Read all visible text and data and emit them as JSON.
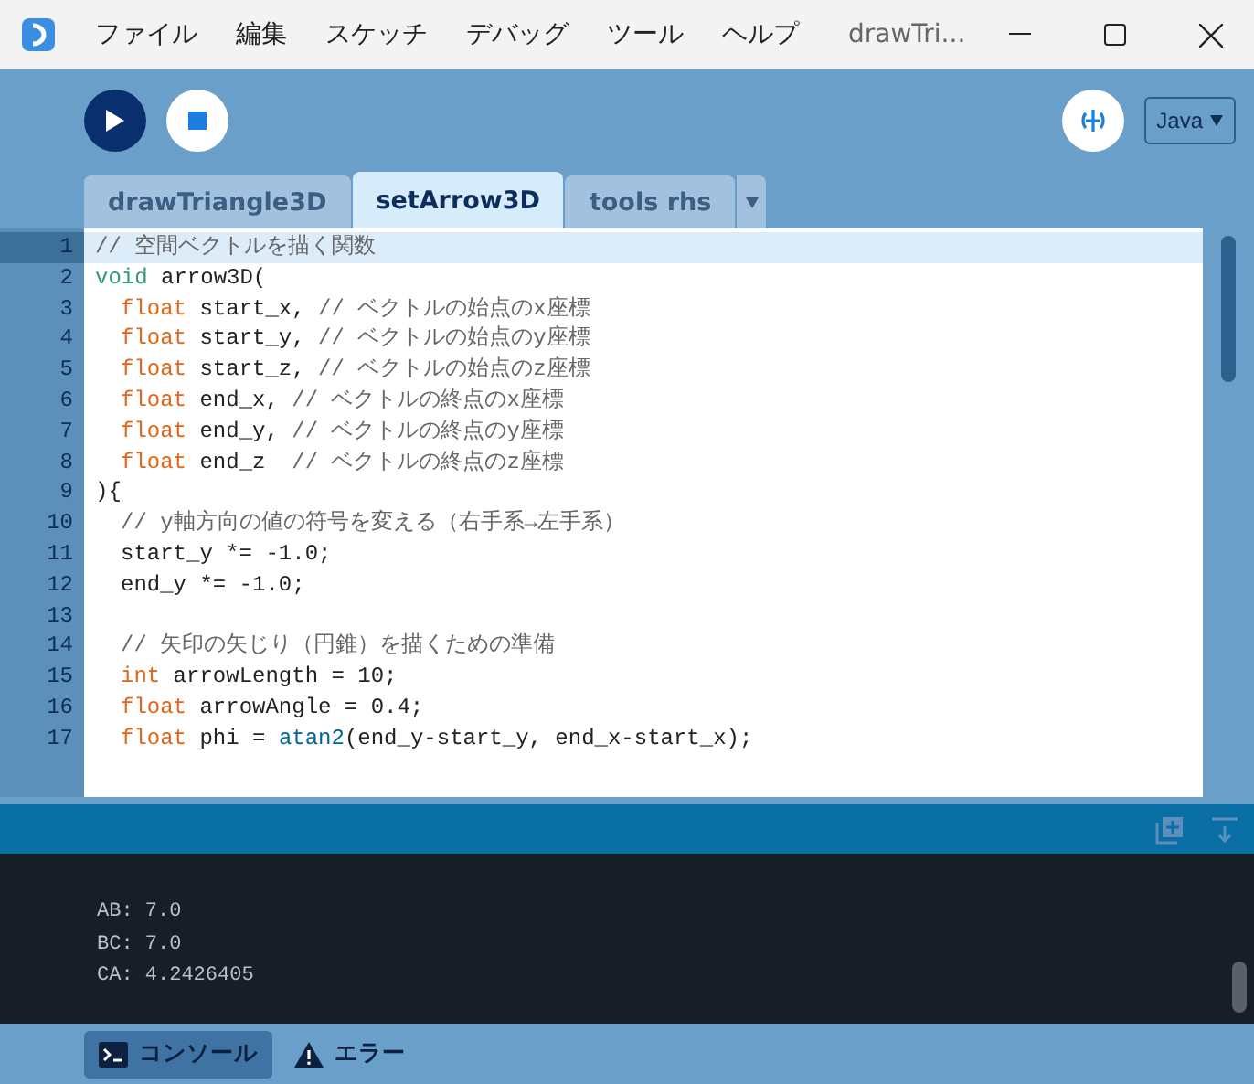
{
  "window": {
    "menu": [
      "ファイル",
      "編集",
      "スケッチ",
      "デバッグ",
      "ツール",
      "ヘルプ"
    ],
    "title": "drawTri..."
  },
  "toolbar": {
    "mode": "Java"
  },
  "tabs": [
    {
      "label": "drawTriangle3D",
      "selected": false
    },
    {
      "label": "setArrow3D",
      "selected": true
    },
    {
      "label": "tools rhs",
      "selected": false
    }
  ],
  "editor": {
    "lines": [
      {
        "number": "1",
        "selected": true,
        "indented": false,
        "tokens": [
          {
            "kind": "comment",
            "text": "// 空間ベクトルを描く関数"
          }
        ]
      },
      {
        "number": "2",
        "selected": false,
        "indented": false,
        "tokens": [
          {
            "kind": "keyword",
            "text": "void"
          },
          {
            "kind": "plain",
            "text": " arrow3D("
          }
        ]
      },
      {
        "number": "3",
        "selected": false,
        "indented": true,
        "tokens": [
          {
            "kind": "type",
            "text": "float"
          },
          {
            "kind": "plain",
            "text": " start_x, "
          },
          {
            "kind": "comment",
            "text": "// ベクトルの始点のx座標"
          }
        ]
      },
      {
        "number": "4",
        "selected": false,
        "indented": true,
        "tokens": [
          {
            "kind": "type",
            "text": "float"
          },
          {
            "kind": "plain",
            "text": " start_y, "
          },
          {
            "kind": "comment",
            "text": "// ベクトルの始点のy座標"
          }
        ]
      },
      {
        "number": "5",
        "selected": false,
        "indented": true,
        "tokens": [
          {
            "kind": "type",
            "text": "float"
          },
          {
            "kind": "plain",
            "text": " start_z, "
          },
          {
            "kind": "comment",
            "text": "// ベクトルの始点のz座標"
          }
        ]
      },
      {
        "number": "6",
        "selected": false,
        "indented": true,
        "tokens": [
          {
            "kind": "type",
            "text": "float"
          },
          {
            "kind": "plain",
            "text": " end_x, "
          },
          {
            "kind": "comment",
            "text": "// ベクトルの終点のx座標"
          }
        ]
      },
      {
        "number": "7",
        "selected": false,
        "indented": true,
        "tokens": [
          {
            "kind": "type",
            "text": "float"
          },
          {
            "kind": "plain",
            "text": " end_y, "
          },
          {
            "kind": "comment",
            "text": "// ベクトルの終点のy座標"
          }
        ]
      },
      {
        "number": "8",
        "selected": false,
        "indented": true,
        "tokens": [
          {
            "kind": "type",
            "text": "float"
          },
          {
            "kind": "plain",
            "text": " end_z  "
          },
          {
            "kind": "comment",
            "text": "// ベクトルの終点のz座標"
          }
        ]
      },
      {
        "number": "9",
        "selected": false,
        "indented": false,
        "tokens": [
          {
            "kind": "plain",
            "text": "){"
          }
        ]
      },
      {
        "number": "10",
        "selected": false,
        "indented": true,
        "tokens": [
          {
            "kind": "comment",
            "text": "// y軸方向の値の符号を変える（右手系→左手系）"
          }
        ]
      },
      {
        "number": "11",
        "selected": false,
        "indented": true,
        "tokens": [
          {
            "kind": "plain",
            "text": "start_y *= -1.0;"
          }
        ]
      },
      {
        "number": "12",
        "selected": false,
        "indented": true,
        "tokens": [
          {
            "kind": "plain",
            "text": "end_y *= -1.0;"
          }
        ]
      },
      {
        "number": "13",
        "selected": false
      },
      {
        "number": "14",
        "selected": false,
        "indented": true,
        "tokens": [
          {
            "kind": "comment",
            "text": "// 矢印の矢じり（円錐）を描くための準備"
          }
        ]
      },
      {
        "number": "15",
        "selected": false,
        "indented": true,
        "tokens": [
          {
            "kind": "type",
            "text": "int"
          },
          {
            "kind": "plain",
            "text": " arrowLength = 10;"
          }
        ]
      },
      {
        "number": "16",
        "selected": false,
        "indented": true,
        "tokens": [
          {
            "kind": "type",
            "text": "float"
          },
          {
            "kind": "plain",
            "text": " arrowAngle = 0.4;"
          }
        ]
      },
      {
        "number": "17",
        "selected": false,
        "indented": true,
        "tokens": [
          {
            "kind": "type",
            "text": "float"
          },
          {
            "kind": "plain",
            "text": " phi = "
          },
          {
            "kind": "func",
            "text": "atan2"
          },
          {
            "kind": "plain",
            "text": "(end_y-start_y, end_x-start_x);"
          }
        ]
      }
    ]
  },
  "console": {
    "lines": [
      "AB: 7.0",
      "BC: 7.0",
      "CA: 4.2426405"
    ]
  },
  "bottom_tabs": [
    {
      "label": "コンソール",
      "selected": true,
      "kind": "console"
    },
    {
      "label": "エラー",
      "selected": false,
      "kind": "error"
    }
  ]
}
